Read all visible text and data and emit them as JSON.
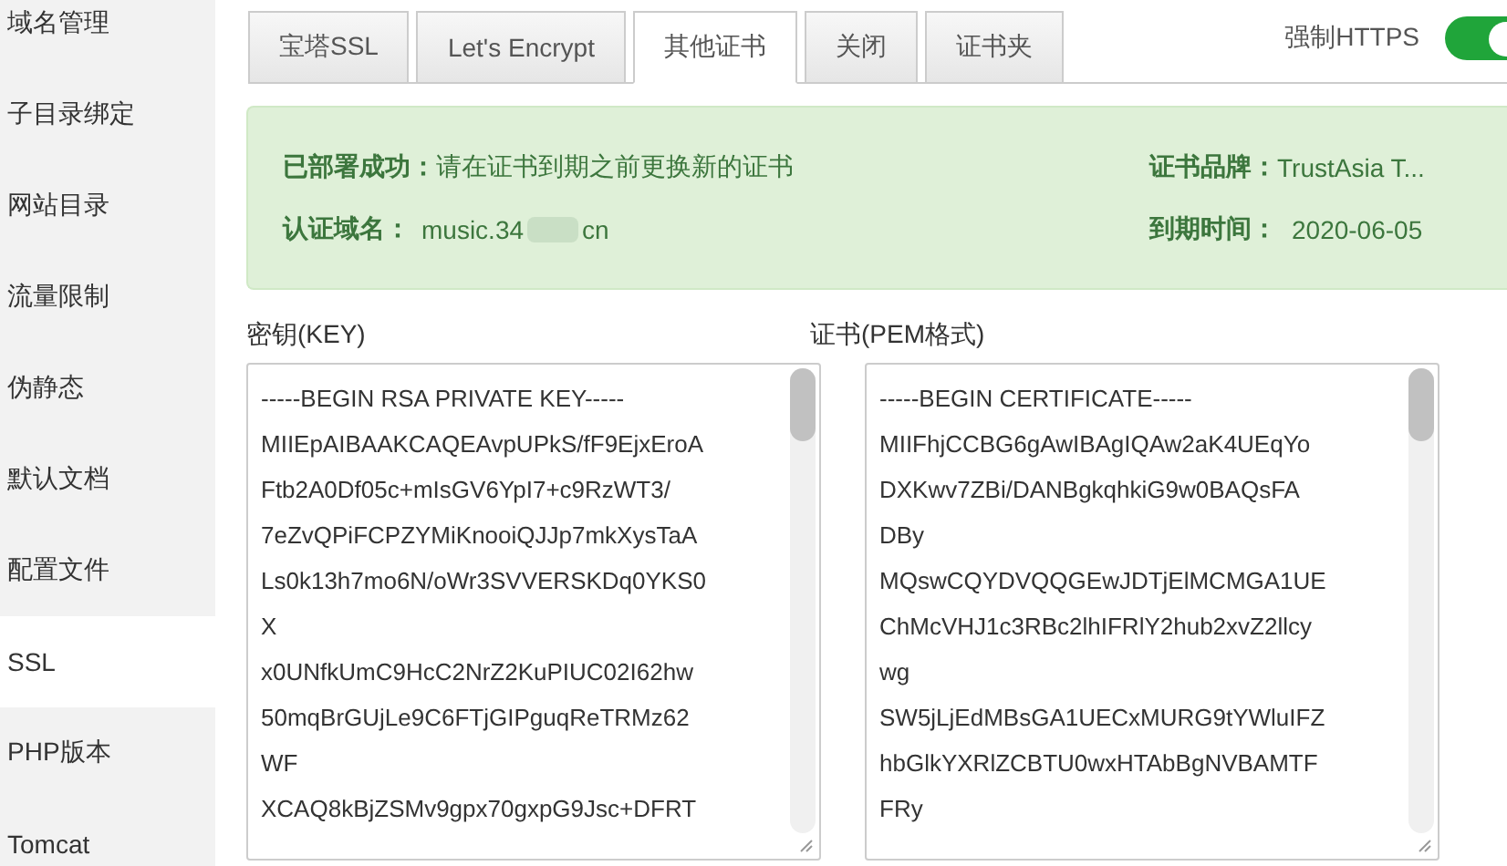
{
  "sidebar": {
    "items": [
      {
        "label": "域名管理",
        "selected": false
      },
      {
        "label": "子目录绑定",
        "selected": false
      },
      {
        "label": "网站目录",
        "selected": false
      },
      {
        "label": "流量限制",
        "selected": false
      },
      {
        "label": "伪静态",
        "selected": false
      },
      {
        "label": "默认文档",
        "selected": false
      },
      {
        "label": "配置文件",
        "selected": false
      },
      {
        "label": "SSL",
        "selected": true
      },
      {
        "label": "PHP版本",
        "selected": false
      },
      {
        "label": "Tomcat",
        "selected": false
      }
    ]
  },
  "tabs": [
    {
      "label": "宝塔SSL",
      "selected": false
    },
    {
      "label": "Let's Encrypt",
      "selected": false
    },
    {
      "label": "其他证书",
      "selected": true
    },
    {
      "label": "关闭",
      "selected": false
    },
    {
      "label": "证书夹",
      "selected": false
    }
  ],
  "force_https": {
    "label": "强制HTTPS",
    "on": true
  },
  "status": {
    "deployed_label": "已部署成功：",
    "deployed_text": "请在证书到期之前更换新的证书",
    "domain_label": "认证域名：",
    "domain_prefix": "music.34",
    "domain_suffix": "cn",
    "brand_label": "证书品牌：",
    "brand": "TrustAsia T...",
    "expiry_label": "到期时间：",
    "expiry": "2020-06-05"
  },
  "key": {
    "label": "密钥(KEY)",
    "lines": [
      "-----BEGIN RSA PRIVATE KEY-----",
      "MIIEpAIBAAKCAQEAvpUPkS/fF9EjxEroA",
      "Ftb2A0Df05c+mIsGV6YpI7+c9RzWT3/",
      "7eZvQPiFCPZYMiKnooiQJJp7mkXysTaA",
      "Ls0k13h7mo6N/oWr3SVVERSKDq0YKS0",
      "X",
      "x0UNfkUmC9HcC2NrZ2KuPIUC02I62hw",
      "50mqBrGUjLe9C6FTjGIPguqReTRMz62",
      "WF",
      "XCAQ8kBjZSMv9gpx70gxpG9Jsc+DFRT"
    ]
  },
  "certificate": {
    "label": "证书(PEM格式)",
    "lines": [
      "-----BEGIN CERTIFICATE-----",
      "MIIFhjCCBG6gAwIBAgIQAw2aK4UEqYo",
      "DXKwv7ZBi/DANBgkqhkiG9w0BAQsFA",
      "DBy",
      "MQswCQYDVQQGEwJDTjElMCMGA1UE",
      "ChMcVHJ1c3RBc2lhIFRlY2hub2xvZ2llcy",
      "wg",
      "SW5jLjEdMBsGA1UECxMURG9tYWluIFZ",
      "hbGlkYXRlZCBTU0wxHTAbBgNVBAMTF",
      "FRy"
    ]
  }
}
